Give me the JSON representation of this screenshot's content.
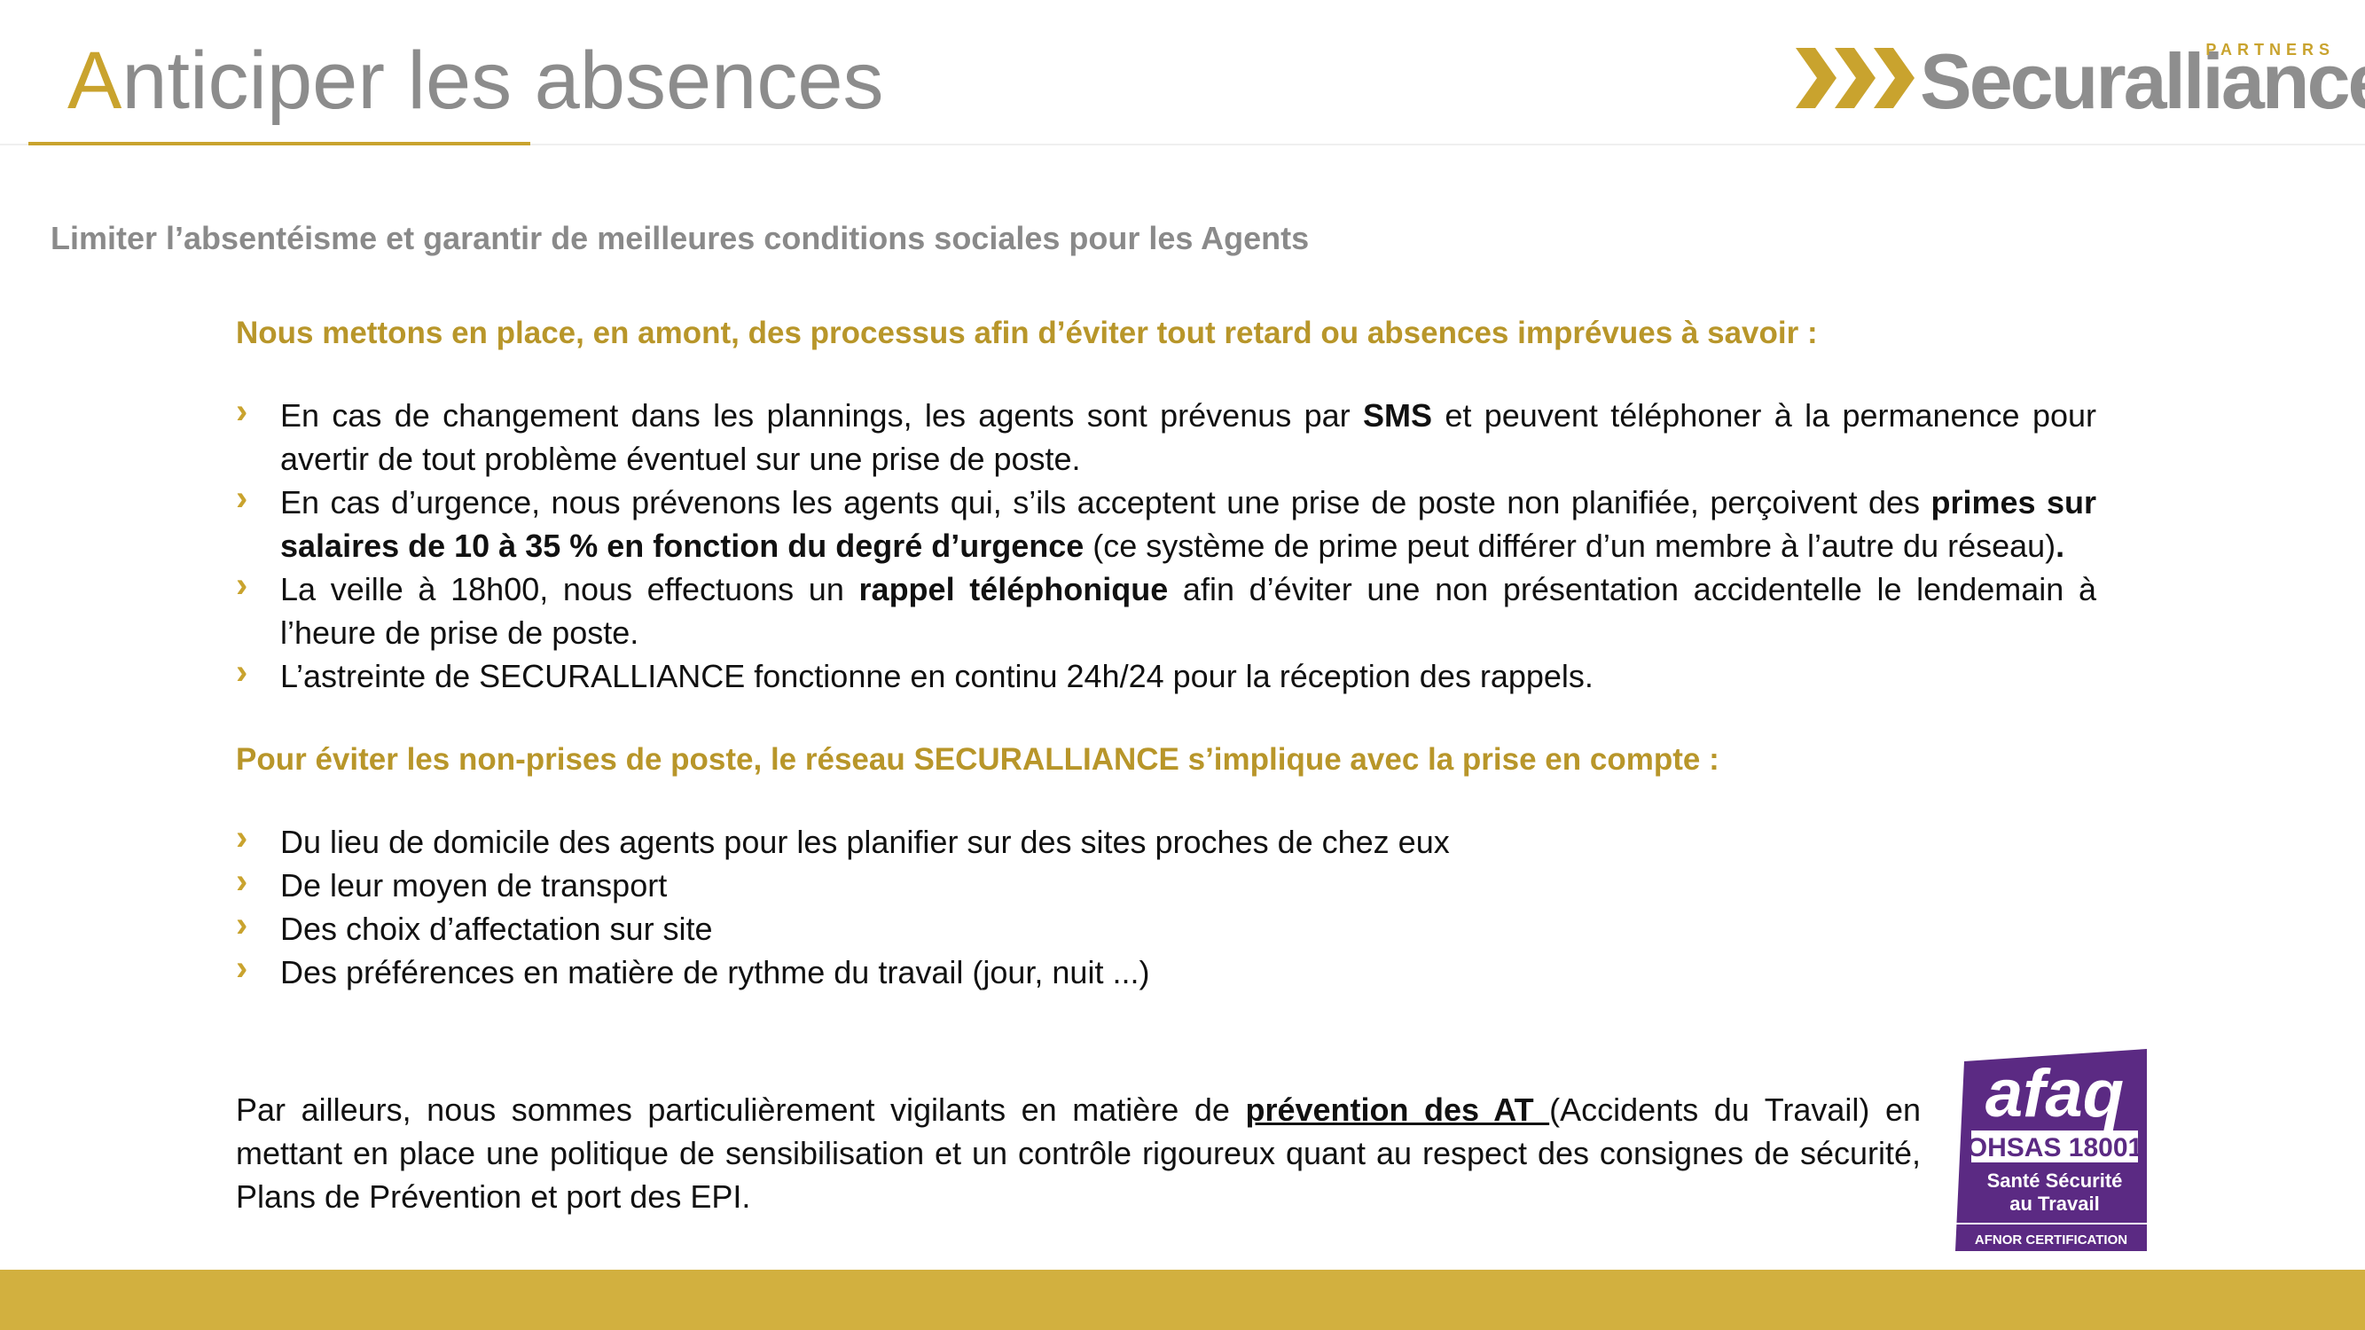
{
  "header": {
    "title_first_letter": "A",
    "title_rest": "nticiper les absences",
    "logo_name": "Securalliance",
    "logo_tag": "PARTNERS"
  },
  "subtitle": "Limiter l’absentéisme et garantir de meilleures conditions sociales pour les Agents",
  "section1": {
    "heading": "Nous mettons en place, en amont, des processus afin d’éviter tout retard ou absences imprévues à savoir :",
    "items": [
      [
        {
          "t": "En cas de changement dans les plannings, les agents sont prévenus par "
        },
        {
          "t": "SMS",
          "b": true
        },
        {
          "t": " et peuvent téléphoner à la permanence pour avertir de tout problème éventuel sur une prise de poste."
        }
      ],
      [
        {
          "t": "En cas d’urgence, nous prévenons les agents qui, s’ils acceptent une prise de poste non planifiée, perçoivent des "
        },
        {
          "t": "primes sur salaires de 10 à 35 % en fonction du degré d’urgence",
          "b": true
        },
        {
          "t": " (ce système de prime peut différer d’un membre à l’autre du réseau)"
        },
        {
          "t": ".",
          "b": true
        }
      ],
      [
        {
          "t": "La veille à 18h00, nous effectuons un "
        },
        {
          "t": "rappel téléphonique",
          "b": true
        },
        {
          "t": " afin d’éviter une non présentation accidentelle le lendemain à l’heure de prise de poste."
        }
      ],
      [
        {
          "t": "L’astreinte de SECURALLIANCE fonctionne en continu 24h/24 pour la réception des rappels."
        }
      ]
    ]
  },
  "section2": {
    "heading": "Pour éviter les non-prises de poste, le réseau SECURALLIANCE s’implique avec la prise en compte :",
    "items": [
      [
        {
          "t": "Du lieu de domicile des agents pour les planifier sur des sites proches de chez eux"
        }
      ],
      [
        {
          "t": "De leur moyen de transport"
        }
      ],
      [
        {
          "t": "Des choix d’affectation sur site"
        }
      ],
      [
        {
          "t": "Des préférences en matière de rythme du travail (jour, nuit ...)"
        }
      ]
    ]
  },
  "closing": {
    "before": "Par ailleurs, nous sommes particulièrement vigilants en matière de ",
    "underlined": "prévention des AT ",
    "after": "(Accidents du Travail) en mettant en place une politique de sensibilisation et un contrôle rigoureux quant au respect des consignes de sécurité, Plans de Prévention et port des EPI."
  },
  "badge": {
    "brand": "afaq",
    "standard": "OHSAS 18001",
    "line1": "Santé Sécurité",
    "line2": "au Travail",
    "cert": "AFNOR CERTIFICATION"
  },
  "colors": {
    "gold": "#c9a32e",
    "footer_gold": "#d2b03f",
    "grey_text": "#8a8a8a",
    "badge_purple": "#5b2a83"
  }
}
